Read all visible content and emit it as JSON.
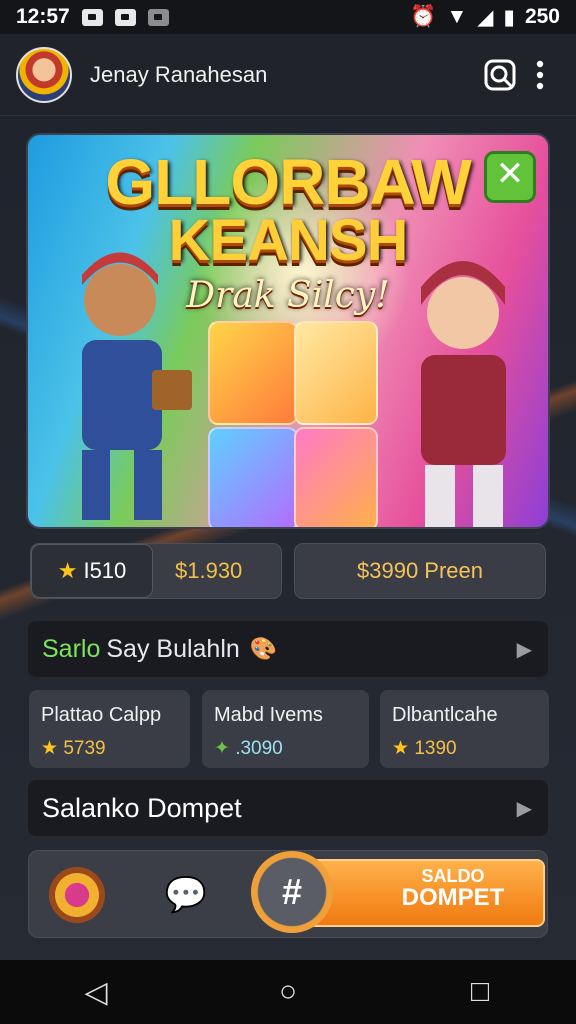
{
  "status_bar": {
    "time": "12:57",
    "battery_text": "250",
    "notif_icons": [
      "picture-icon",
      "camera-icon",
      "tray-icon"
    ]
  },
  "app_bar": {
    "username": "Jenay Ranahesan",
    "search_icon": "search-icon",
    "menu_icon": "more-vert-icon"
  },
  "banner": {
    "title_line1": "GLLORBAW",
    "title_line2": "KEANSH",
    "subtitle": "Drak Silcy!",
    "close_icon": "close-icon"
  },
  "balance_row": {
    "stars": "I510",
    "amount_left": "$1.930",
    "amount_right": "$3990 Preen"
  },
  "section_header": {
    "prefix": "Sarlo",
    "title": "Say Bulahln",
    "icon": "palette-icon"
  },
  "stats": [
    {
      "label": "Plattao Calpp",
      "value": "5739",
      "icon": "star-icon"
    },
    {
      "label": "Mabd Ivems",
      "value": ".3090",
      "icon": "leaf-icon"
    },
    {
      "label": "Dlbantlcahe",
      "value": "1390",
      "icon": "star-icon"
    }
  ],
  "wallet_row": {
    "label": "Salanko Dompet"
  },
  "bottom_bar": {
    "button_line1": "SALDO",
    "button_line2": "DOMPET",
    "chat_icon": "chat-icon",
    "badge_icon": "badge-icon",
    "plus_icon": "hashtag-icon"
  },
  "nav": {
    "back": "back-icon",
    "home": "home-icon",
    "recents": "recents-icon"
  }
}
